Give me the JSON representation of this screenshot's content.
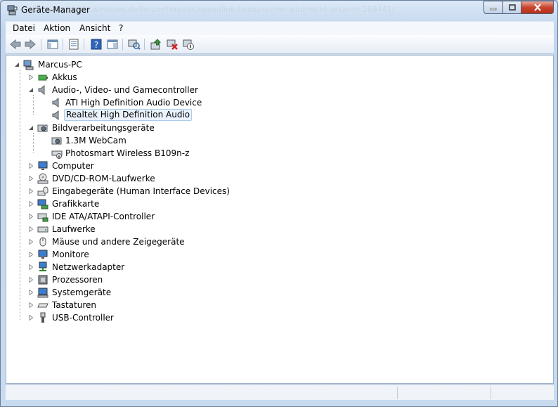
{
  "window": {
    "title": "Geräte-Manager",
    "url_ghost": "...windows.de/forum/threads/speedlink-lautsprecher-wird-nicht-erkannt.269441/"
  },
  "menu": {
    "items": [
      "Datei",
      "Aktion",
      "Ansicht",
      "?"
    ]
  },
  "toolbar": {
    "buttons": [
      "back-icon",
      "forward-icon",
      "show-hide-console-tree-icon",
      "properties-icon",
      "help-icon",
      "action-pane-icon",
      "scan-hardware-icon",
      "update-driver-icon",
      "uninstall-icon",
      "disable-icon"
    ]
  },
  "tree": {
    "root": "Marcus-PC",
    "items": [
      {
        "label": "Akkus"
      },
      {
        "label": "Audio-, Video- und Gamecontroller"
      },
      {
        "label": "ATI High Definition Audio Device"
      },
      {
        "label": "Realtek High Definition Audio",
        "selected": true
      },
      {
        "label": "Bildverarbeitungsgeräte"
      },
      {
        "label": "1.3M WebCam"
      },
      {
        "label": "Photosmart Wireless B109n-z"
      },
      {
        "label": "Computer"
      },
      {
        "label": "DVD/CD-ROM-Laufwerke"
      },
      {
        "label": "Eingabegeräte (Human Interface Devices)"
      },
      {
        "label": "Grafikkarte"
      },
      {
        "label": "IDE ATA/ATAPI-Controller"
      },
      {
        "label": "Laufwerke"
      },
      {
        "label": "Mäuse und andere Zeigegeräte"
      },
      {
        "label": "Monitore"
      },
      {
        "label": "Netzwerkadapter"
      },
      {
        "label": "Prozessoren"
      },
      {
        "label": "Systemgeräte"
      },
      {
        "label": "Tastaturen"
      },
      {
        "label": "USB-Controller"
      }
    ]
  },
  "colors": {
    "selection_bg": "#eaf3fd",
    "selection_border": "#a9cdee",
    "close_button": "#c9442d"
  }
}
